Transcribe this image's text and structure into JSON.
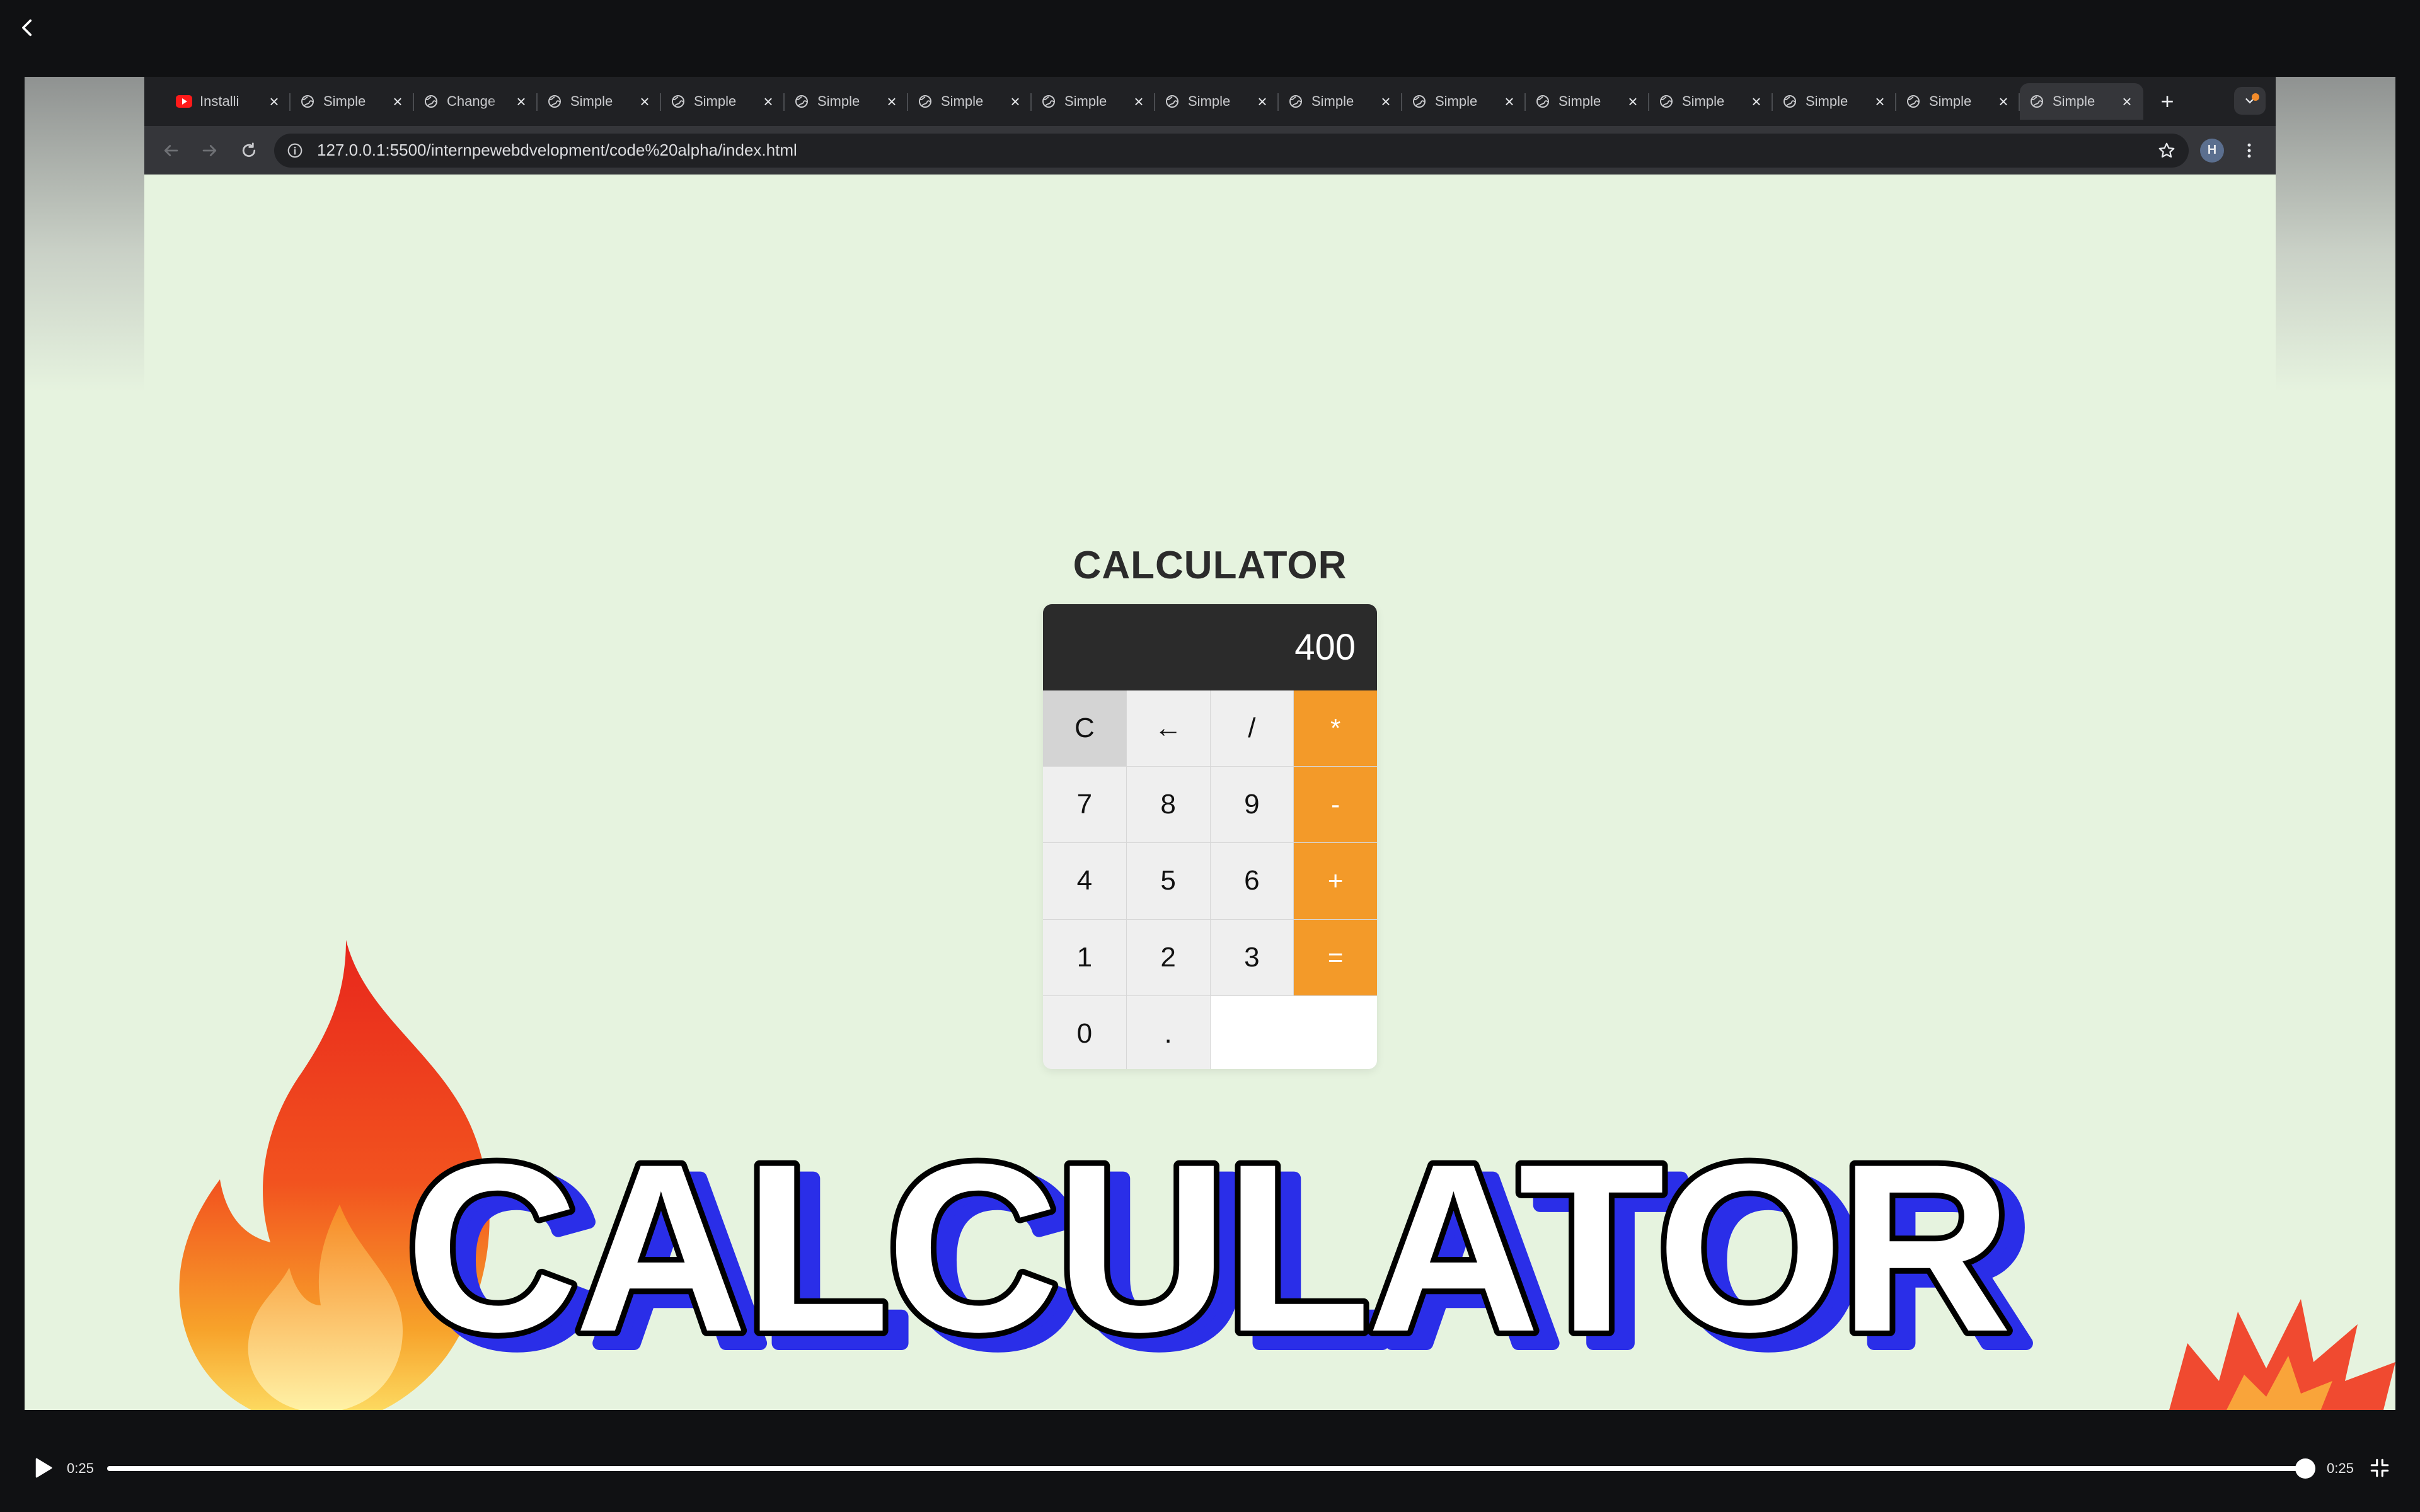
{
  "player": {
    "back_icon": "chevron-left-icon",
    "current_time": "0:25",
    "duration": "0:25",
    "progress_fraction": 1.0,
    "play_icon": "play-icon",
    "fullscreen_icon": "exit-fullscreen-icon"
  },
  "browser": {
    "tabs": [
      {
        "title": "Installi",
        "icon": "youtube-icon",
        "active": false
      },
      {
        "title": "Simple",
        "icon": "globe-icon",
        "active": false
      },
      {
        "title": "Change",
        "icon": "globe-icon",
        "active": false
      },
      {
        "title": "Simple",
        "icon": "globe-icon",
        "active": false
      },
      {
        "title": "Simple",
        "icon": "globe-icon",
        "active": false
      },
      {
        "title": "Simple",
        "icon": "globe-icon",
        "active": false
      },
      {
        "title": "Simple",
        "icon": "globe-icon",
        "active": false
      },
      {
        "title": "Simple",
        "icon": "globe-icon",
        "active": false
      },
      {
        "title": "Simple",
        "icon": "globe-icon",
        "active": false
      },
      {
        "title": "Simple",
        "icon": "globe-icon",
        "active": false
      },
      {
        "title": "Simple",
        "icon": "globe-icon",
        "active": false
      },
      {
        "title": "Simple",
        "icon": "globe-icon",
        "active": false
      },
      {
        "title": "Simple",
        "icon": "globe-icon",
        "active": false
      },
      {
        "title": "Simple",
        "icon": "globe-icon",
        "active": false
      },
      {
        "title": "Simple",
        "icon": "globe-icon",
        "active": false
      },
      {
        "title": "Simple",
        "icon": "globe-icon",
        "active": true
      }
    ],
    "url": "127.0.0.1:5500/internpewebdvelopment/code%20alpha/index.html",
    "profile_initial": "H"
  },
  "calculator": {
    "title": "CALCULATOR",
    "display": "400",
    "keys": [
      {
        "label": "C",
        "kind": "clear"
      },
      {
        "label": "←",
        "kind": "num"
      },
      {
        "label": "/",
        "kind": "num"
      },
      {
        "label": "*",
        "kind": "op"
      },
      {
        "label": "7",
        "kind": "num"
      },
      {
        "label": "8",
        "kind": "num"
      },
      {
        "label": "9",
        "kind": "num"
      },
      {
        "label": "-",
        "kind": "op"
      },
      {
        "label": "4",
        "kind": "num"
      },
      {
        "label": "5",
        "kind": "num"
      },
      {
        "label": "6",
        "kind": "num"
      },
      {
        "label": "+",
        "kind": "op"
      },
      {
        "label": "1",
        "kind": "num"
      },
      {
        "label": "2",
        "kind": "num"
      },
      {
        "label": "3",
        "kind": "num"
      },
      {
        "label": "=",
        "kind": "op"
      },
      {
        "label": "0",
        "kind": "num"
      },
      {
        "label": ".",
        "kind": "num"
      },
      {
        "label": "",
        "kind": "blank"
      }
    ]
  },
  "overlay": {
    "headline": "CALCULATOR"
  },
  "colors": {
    "page_bg": "#e6f3df",
    "operator": "#f39a29",
    "display_bg": "#2b2b2b",
    "headline_shadow": "#2a2ee8"
  }
}
